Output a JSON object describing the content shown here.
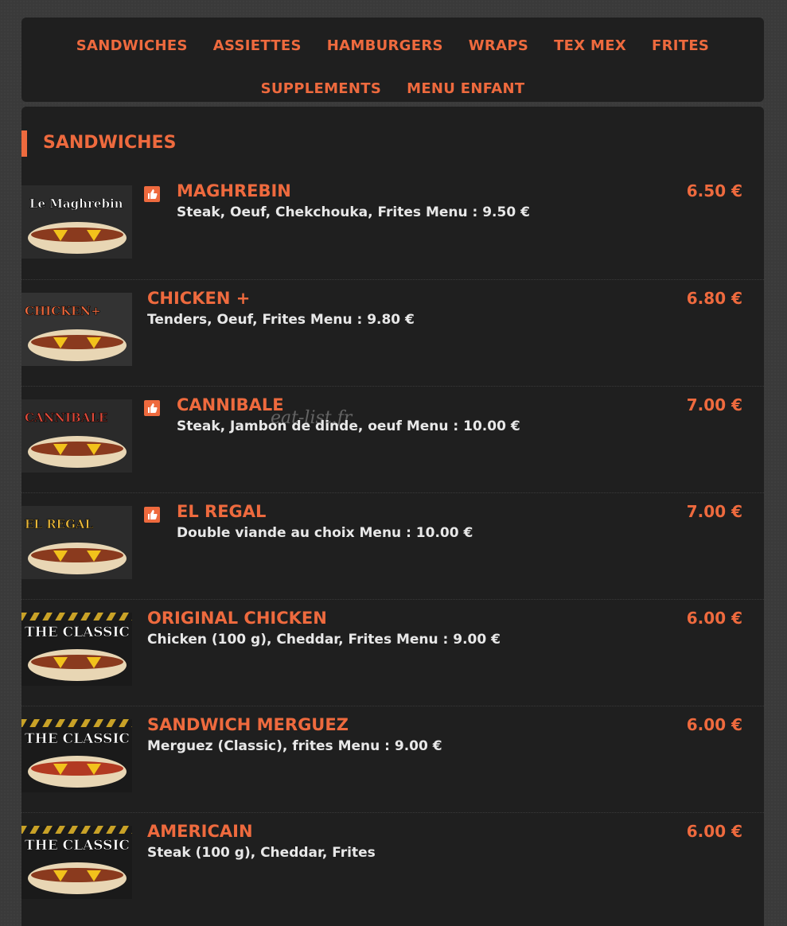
{
  "nav": {
    "items": [
      "SANDWICHES",
      "ASSIETTES",
      "HAMBURGERS",
      "WRAPS",
      "TEX MEX",
      "FRITES",
      "SUPPLEMENTS",
      "MENU ENFANT"
    ]
  },
  "section": {
    "title": "SANDWICHES"
  },
  "watermark": "eat-list.fr",
  "colors": {
    "accent": "#ee6a3e",
    "panel": "#1f1f1f",
    "text": "#e8e8e8"
  },
  "items": [
    {
      "name": "MAGHREBIN",
      "desc": "Steak, Oeuf, Chekchouka, Frites Menu : 9.50 €",
      "price": "6.50 €",
      "liked": true,
      "thumb_text": "Le Maghrebin"
    },
    {
      "name": "CHICKEN +",
      "desc": "Tenders, Oeuf, Frites Menu : 9.80 €",
      "price": "6.80 €",
      "liked": false,
      "thumb_text": "CHICKEN+"
    },
    {
      "name": "CANNIBALE",
      "desc": "Steak, Jambon de dinde, oeuf Menu : 10.00 €",
      "price": "7.00 €",
      "liked": true,
      "thumb_text": "CANNIBALE"
    },
    {
      "name": "EL REGAL",
      "desc": "Double viande au choix Menu : 10.00 €",
      "price": "7.00 €",
      "liked": true,
      "thumb_text": "EL REGAL"
    },
    {
      "name": "ORIGINAL CHICKEN",
      "desc": "Chicken (100 g), Cheddar, Frites Menu : 9.00 €",
      "price": "6.00 €",
      "liked": false,
      "thumb_text": "THE CLASSIC"
    },
    {
      "name": "SANDWICH MERGUEZ",
      "desc": "Merguez (Classic), frites Menu : 9.00 €",
      "price": "6.00 €",
      "liked": false,
      "thumb_text": "THE CLASSIC"
    },
    {
      "name": "AMERICAIN",
      "desc": "Steak (100 g), Cheddar, Frites",
      "price": "6.00 €",
      "liked": false,
      "thumb_text": "THE CLASSIC"
    }
  ]
}
